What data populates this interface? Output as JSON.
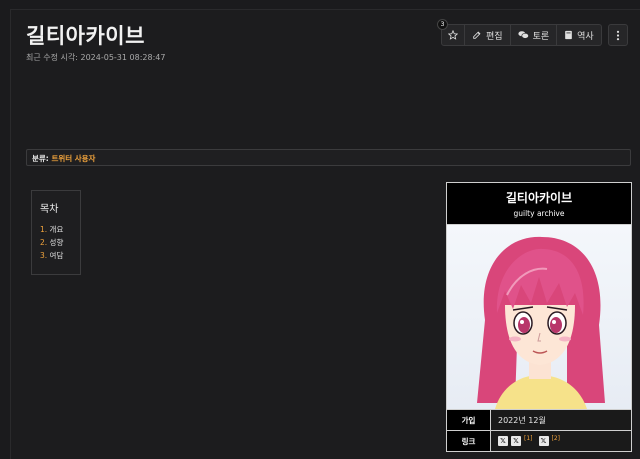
{
  "page": {
    "title": "길티아카이브",
    "modified": "최근 수정 시각: 2024-05-31 08:28:47"
  },
  "toolbar": {
    "star_count": "3",
    "edit_label": "편집",
    "discuss_label": "토론",
    "history_label": "역사"
  },
  "category": {
    "prefix": "분류:",
    "link": "트위터 사용자"
  },
  "toc": {
    "title": "목차",
    "items": [
      {
        "num": "1.",
        "label": "개요"
      },
      {
        "num": "2.",
        "label": "성향"
      },
      {
        "num": "3.",
        "label": "여담"
      }
    ]
  },
  "infobox": {
    "title": "길티아카이브",
    "subtitle": "guilty archive",
    "rows": [
      {
        "label": "가입",
        "value": "2022년 12월"
      },
      {
        "label": "링크",
        "refs": [
          "[1]",
          "[2]"
        ]
      }
    ]
  },
  "colors": {
    "background": "#1b1b1d",
    "accent": "#f0a33c",
    "border": "#3b3b3d"
  }
}
